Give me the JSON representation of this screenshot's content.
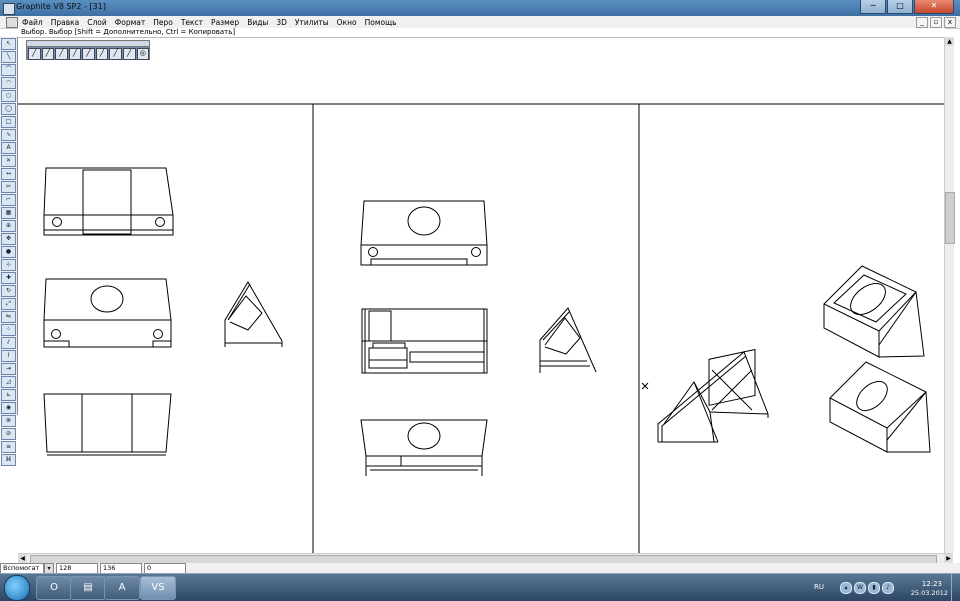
{
  "window": {
    "title": "Graphite V8 SP2 - [31]",
    "min_label": "─",
    "max_label": "□",
    "close_label": "✕"
  },
  "menu": [
    {
      "label": "Файл"
    },
    {
      "label": "Правка"
    },
    {
      "label": "Слой"
    },
    {
      "label": "Формат"
    },
    {
      "label": "Перо"
    },
    {
      "label": "Текст"
    },
    {
      "label": "Размер"
    },
    {
      "label": "Виды"
    },
    {
      "label": "3D"
    },
    {
      "label": "Утилиты"
    },
    {
      "label": "Окно"
    },
    {
      "label": "Помощь"
    }
  ],
  "status": {
    "message": "Выбор. Выбор  [Shift = Дополнительно, Ctrl = Копировать]"
  },
  "bottom": {
    "layer": "Вспомогат",
    "x": "128",
    "y": "136",
    "angle": "0"
  },
  "taskbar": {
    "apps": [
      {
        "name": "opera-icon",
        "glyph": "O"
      },
      {
        "name": "explorer-icon",
        "glyph": "▤"
      },
      {
        "name": "archicad-icon",
        "glyph": "A"
      },
      {
        "name": "graphite-icon",
        "glyph": "VS"
      }
    ],
    "lang": "RU",
    "time": "12:23",
    "date": "25.03.2012"
  },
  "colors": {
    "titlebar": "#3d6fa3",
    "palette": "#6e8eb0",
    "taskbar": "#2c4764"
  }
}
